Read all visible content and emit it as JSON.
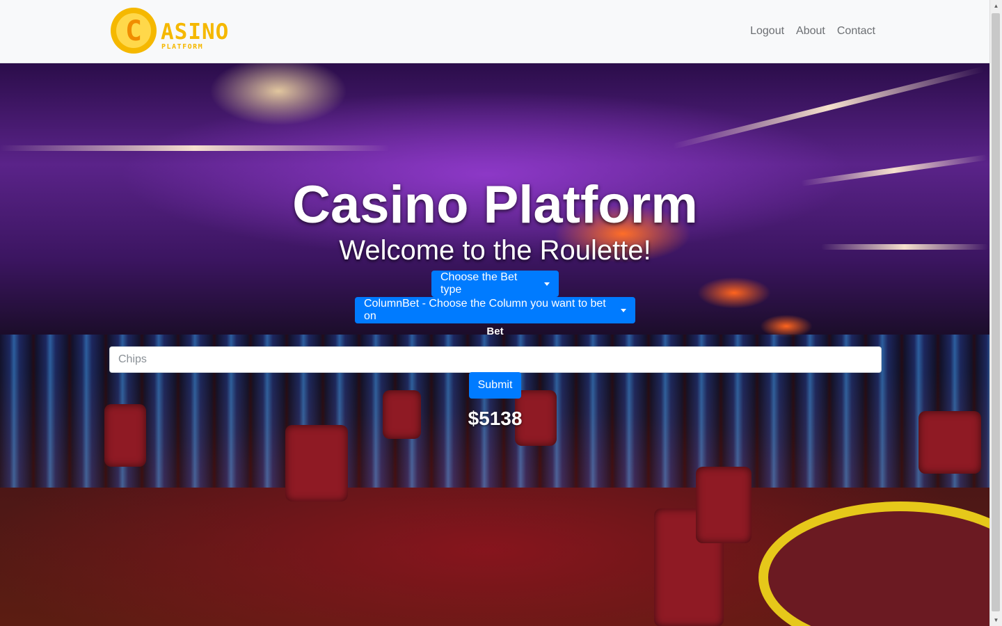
{
  "navbar": {
    "logo": {
      "mark_letter": "C",
      "wordmark": "ASINO",
      "tagline": "PLATFORM",
      "color": "#f5b800"
    },
    "links": [
      {
        "label": "Logout"
      },
      {
        "label": "About"
      },
      {
        "label": "Contact"
      }
    ]
  },
  "hero": {
    "title": "Casino Platform",
    "subtitle": "Welcome to the Roulette!"
  },
  "bet_form": {
    "bet_type_dropdown": "Choose the Bet type",
    "column_dropdown": "ColumnBet - Choose the Column you want to bet on",
    "bet_label": "Bet",
    "chips_placeholder": "Chips",
    "chips_value": "",
    "submit_label": "Submit"
  },
  "balance": "$5138",
  "colors": {
    "primary": "#007bff",
    "navbar_bg": "#f8f9fa",
    "nav_link": "#6c6f73"
  }
}
